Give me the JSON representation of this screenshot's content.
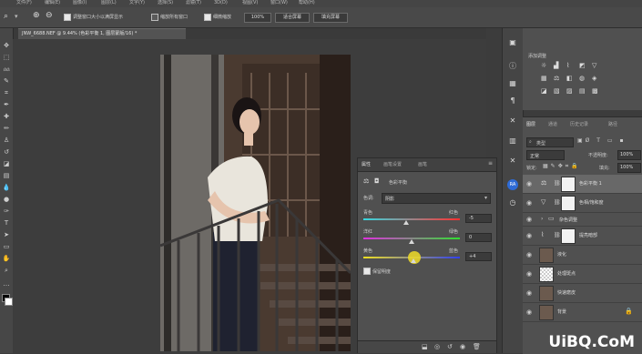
{
  "menu": [
    "文件(F)",
    "编辑(E)",
    "图像(I)",
    "图层(L)",
    "文字(Y)",
    "选择(S)",
    "滤镜(T)",
    "3D(D)",
    "视图(V)",
    "窗口(W)",
    "帮助(H)"
  ],
  "options": {
    "resize_windows": "调整窗口大小以满屏显示",
    "zoom_all": "缩放所有窗口",
    "scrubby_zoom": "细微缩放",
    "zoom_value": "100%",
    "fit_screen": "适合屏幕",
    "fill_screen": "填充屏幕"
  },
  "document": {
    "tab": "JNW_6688.NEF @ 9.44% (色彩平衡 1, 图层蒙版/16) *"
  },
  "properties": {
    "tabs": [
      "属性",
      "画笔设置",
      "画笔"
    ],
    "title": "色彩平衡",
    "tone_label": "色调:",
    "tone_value": "阴影",
    "sliders": [
      {
        "left": "青色",
        "right": "红色",
        "value": "-5",
        "position": 0.47
      },
      {
        "left": "洋红",
        "right": "绿色",
        "value": "0",
        "position": 0.5
      },
      {
        "left": "黄色",
        "right": "蓝色",
        "value": "+4",
        "position": 0.53
      }
    ],
    "preserve_luminosity": "保留明度"
  },
  "adjustments": {
    "title": "添加调整"
  },
  "layers": {
    "tabs": [
      "图层",
      "通道",
      "历史记录",
      "路径"
    ],
    "kind": "类型",
    "blend": "正常",
    "opacity_label": "不透明度:",
    "opacity": "100%",
    "lock_label": "锁定:",
    "fill_label": "填充:",
    "fill": "100%",
    "items": [
      {
        "name": "色彩平衡 1",
        "thumb": "#f2f2f2"
      },
      {
        "name": "色相/饱和度",
        "thumb": "#f2f2f2"
      },
      {
        "name": "杂色调整",
        "thumb": "folder"
      },
      {
        "name": "提亮暗部",
        "thumb": "#f2f2f2"
      },
      {
        "name": "液化",
        "thumb": "photo"
      },
      {
        "name": "处理斑点",
        "thumb": "checker"
      },
      {
        "name": "快速磨皮",
        "thumb": "photo"
      },
      {
        "name": "背景",
        "thumb": "photo"
      }
    ]
  },
  "watermark": "UiBQ.CoM",
  "colors": {
    "accent": "#2e6bd6",
    "panel": "#505050",
    "bg": "#3c3c3c"
  }
}
